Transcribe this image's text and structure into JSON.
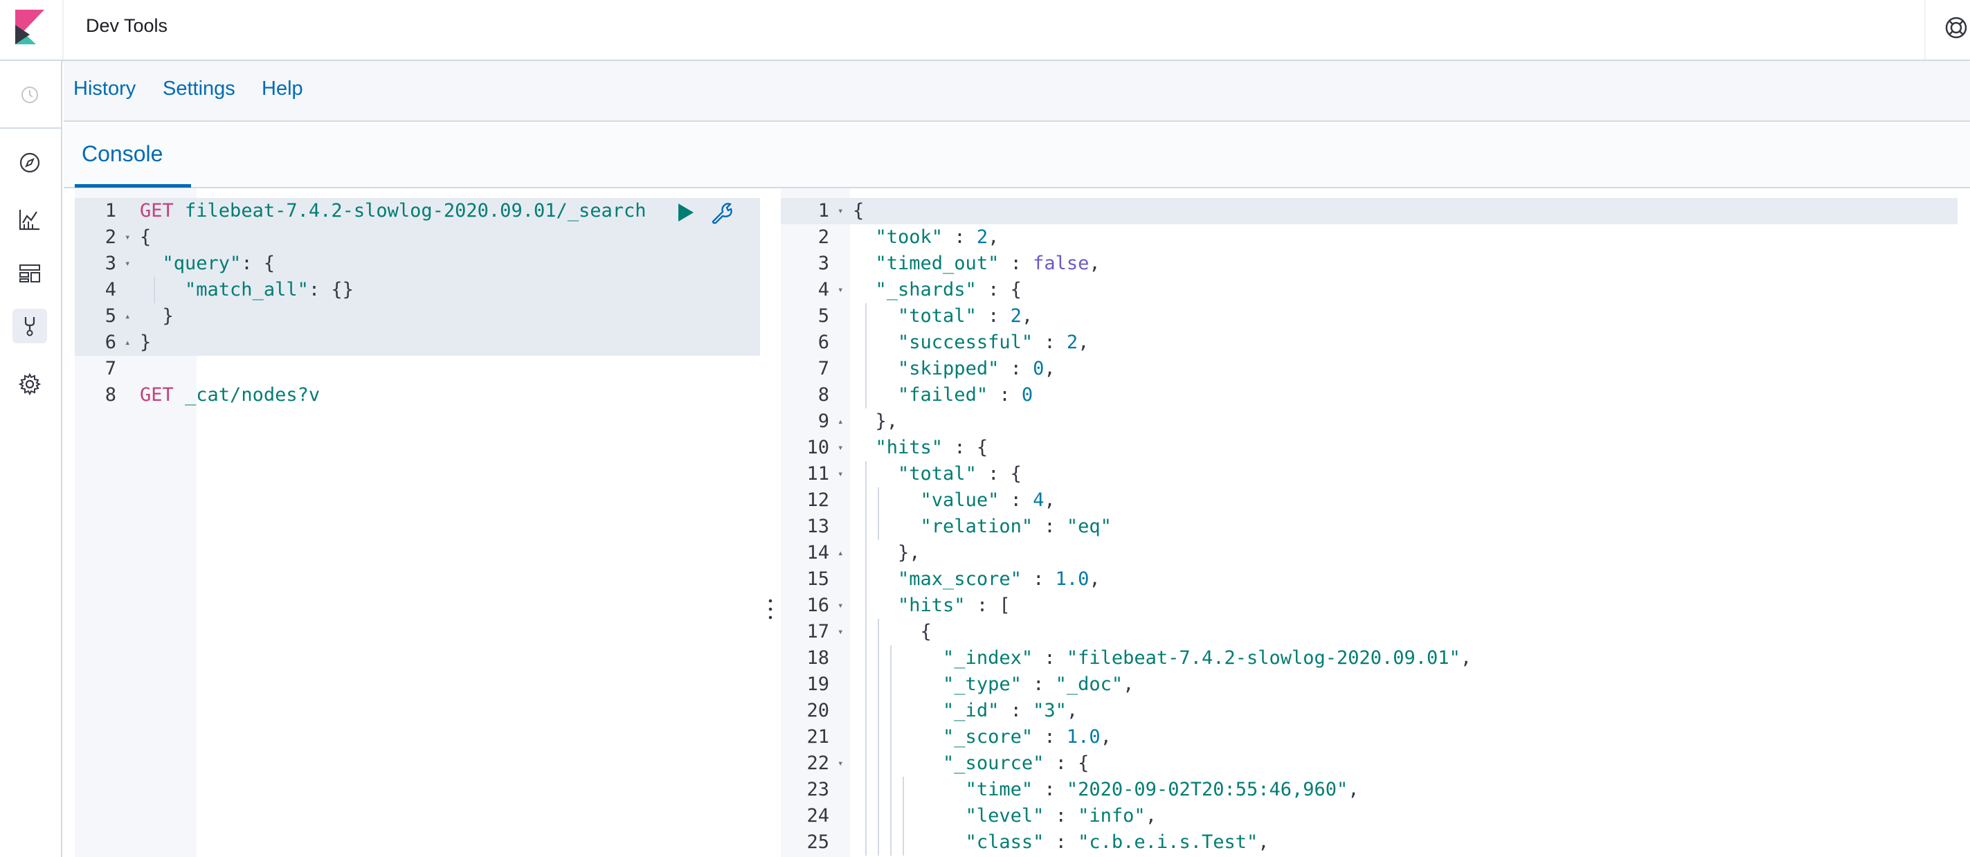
{
  "header": {
    "title": "Dev Tools"
  },
  "topmenu": {
    "items": [
      "History",
      "Settings",
      "Help"
    ]
  },
  "tabs": {
    "active": "Console"
  },
  "nav_icons": [
    "clock-icon",
    "discover-compass-icon",
    "visualize-chart-icon",
    "dashboard-icon",
    "dev-tools-wrench-icon",
    "management-gear-icon"
  ],
  "request": {
    "lines": [
      {
        "n": "1",
        "fold": "",
        "parts": [
          [
            "k-method",
            "GET"
          ],
          [
            "k-url",
            " filebeat-7.4.2-slowlog-2020.09.01/_search"
          ]
        ]
      },
      {
        "n": "2",
        "fold": "▾",
        "parts": [
          [
            "k-punc",
            "{"
          ]
        ]
      },
      {
        "n": "3",
        "fold": "▾",
        "parts": [
          [
            "k-punc",
            "  "
          ],
          [
            "k-key",
            "\"query\""
          ],
          [
            "k-punc",
            ": {"
          ]
        ]
      },
      {
        "n": "4",
        "fold": "",
        "parts": [
          [
            "k-punc",
            "    "
          ],
          [
            "k-key",
            "\"match_all\""
          ],
          [
            "k-punc",
            ": {}"
          ]
        ]
      },
      {
        "n": "5",
        "fold": "▴",
        "parts": [
          [
            "k-punc",
            "  }"
          ]
        ]
      },
      {
        "n": "6",
        "fold": "▴",
        "parts": [
          [
            "k-punc",
            "}"
          ]
        ]
      },
      {
        "n": "7",
        "fold": "",
        "parts": []
      },
      {
        "n": "8",
        "fold": "",
        "parts": [
          [
            "k-method",
            "GET"
          ],
          [
            "k-url",
            " _cat/nodes?v"
          ]
        ]
      }
    ]
  },
  "response": {
    "lines": [
      {
        "n": "1",
        "fold": "▾",
        "parts": [
          [
            "k-punc",
            "{"
          ]
        ]
      },
      {
        "n": "2",
        "fold": "",
        "parts": [
          [
            "k-punc",
            "  "
          ],
          [
            "k-key",
            "\"took\""
          ],
          [
            "k-punc",
            " : "
          ],
          [
            "k-num",
            "2"
          ],
          [
            "k-punc",
            ","
          ]
        ]
      },
      {
        "n": "3",
        "fold": "",
        "parts": [
          [
            "k-punc",
            "  "
          ],
          [
            "k-key",
            "\"timed_out\""
          ],
          [
            "k-punc",
            " : "
          ],
          [
            "k-bool",
            "false"
          ],
          [
            "k-punc",
            ","
          ]
        ]
      },
      {
        "n": "4",
        "fold": "▾",
        "parts": [
          [
            "k-punc",
            "  "
          ],
          [
            "k-key",
            "\"_shards\""
          ],
          [
            "k-punc",
            " : {"
          ]
        ]
      },
      {
        "n": "5",
        "fold": "",
        "parts": [
          [
            "k-punc",
            "    "
          ],
          [
            "k-key",
            "\"total\""
          ],
          [
            "k-punc",
            " : "
          ],
          [
            "k-num",
            "2"
          ],
          [
            "k-punc",
            ","
          ]
        ]
      },
      {
        "n": "6",
        "fold": "",
        "parts": [
          [
            "k-punc",
            "    "
          ],
          [
            "k-key",
            "\"successful\""
          ],
          [
            "k-punc",
            " : "
          ],
          [
            "k-num",
            "2"
          ],
          [
            "k-punc",
            ","
          ]
        ]
      },
      {
        "n": "7",
        "fold": "",
        "parts": [
          [
            "k-punc",
            "    "
          ],
          [
            "k-key",
            "\"skipped\""
          ],
          [
            "k-punc",
            " : "
          ],
          [
            "k-num",
            "0"
          ],
          [
            "k-punc",
            ","
          ]
        ]
      },
      {
        "n": "8",
        "fold": "",
        "parts": [
          [
            "k-punc",
            "    "
          ],
          [
            "k-key",
            "\"failed\""
          ],
          [
            "k-punc",
            " : "
          ],
          [
            "k-num",
            "0"
          ]
        ]
      },
      {
        "n": "9",
        "fold": "▴",
        "parts": [
          [
            "k-punc",
            "  },"
          ]
        ]
      },
      {
        "n": "10",
        "fold": "▾",
        "parts": [
          [
            "k-punc",
            "  "
          ],
          [
            "k-key",
            "\"hits\""
          ],
          [
            "k-punc",
            " : {"
          ]
        ]
      },
      {
        "n": "11",
        "fold": "▾",
        "parts": [
          [
            "k-punc",
            "    "
          ],
          [
            "k-key",
            "\"total\""
          ],
          [
            "k-punc",
            " : {"
          ]
        ]
      },
      {
        "n": "12",
        "fold": "",
        "parts": [
          [
            "k-punc",
            "      "
          ],
          [
            "k-key",
            "\"value\""
          ],
          [
            "k-punc",
            " : "
          ],
          [
            "k-num",
            "4"
          ],
          [
            "k-punc",
            ","
          ]
        ]
      },
      {
        "n": "13",
        "fold": "",
        "parts": [
          [
            "k-punc",
            "      "
          ],
          [
            "k-key",
            "\"relation\""
          ],
          [
            "k-punc",
            " : "
          ],
          [
            "k-str",
            "\"eq\""
          ]
        ]
      },
      {
        "n": "14",
        "fold": "▴",
        "parts": [
          [
            "k-punc",
            "    },"
          ]
        ]
      },
      {
        "n": "15",
        "fold": "",
        "parts": [
          [
            "k-punc",
            "    "
          ],
          [
            "k-key",
            "\"max_score\""
          ],
          [
            "k-punc",
            " : "
          ],
          [
            "k-num",
            "1.0"
          ],
          [
            "k-punc",
            ","
          ]
        ]
      },
      {
        "n": "16",
        "fold": "▾",
        "parts": [
          [
            "k-punc",
            "    "
          ],
          [
            "k-key",
            "\"hits\""
          ],
          [
            "k-punc",
            " : ["
          ]
        ]
      },
      {
        "n": "17",
        "fold": "▾",
        "parts": [
          [
            "k-punc",
            "      {"
          ]
        ]
      },
      {
        "n": "18",
        "fold": "",
        "parts": [
          [
            "k-punc",
            "        "
          ],
          [
            "k-key",
            "\"_index\""
          ],
          [
            "k-punc",
            " : "
          ],
          [
            "k-str",
            "\"filebeat-7.4.2-slowlog-2020.09.01\""
          ],
          [
            "k-punc",
            ","
          ]
        ]
      },
      {
        "n": "19",
        "fold": "",
        "parts": [
          [
            "k-punc",
            "        "
          ],
          [
            "k-key",
            "\"_type\""
          ],
          [
            "k-punc",
            " : "
          ],
          [
            "k-str",
            "\"_doc\""
          ],
          [
            "k-punc",
            ","
          ]
        ]
      },
      {
        "n": "20",
        "fold": "",
        "parts": [
          [
            "k-punc",
            "        "
          ],
          [
            "k-key",
            "\"_id\""
          ],
          [
            "k-punc",
            " : "
          ],
          [
            "k-str",
            "\"3\""
          ],
          [
            "k-punc",
            ","
          ]
        ]
      },
      {
        "n": "21",
        "fold": "",
        "parts": [
          [
            "k-punc",
            "        "
          ],
          [
            "k-key",
            "\"_score\""
          ],
          [
            "k-punc",
            " : "
          ],
          [
            "k-num",
            "1.0"
          ],
          [
            "k-punc",
            ","
          ]
        ]
      },
      {
        "n": "22",
        "fold": "▾",
        "parts": [
          [
            "k-punc",
            "        "
          ],
          [
            "k-key",
            "\"_source\""
          ],
          [
            "k-punc",
            " : {"
          ]
        ]
      },
      {
        "n": "23",
        "fold": "",
        "parts": [
          [
            "k-punc",
            "          "
          ],
          [
            "k-key",
            "\"time\""
          ],
          [
            "k-punc",
            " : "
          ],
          [
            "k-str",
            "\"2020-09-02T20:55:46,960\""
          ],
          [
            "k-punc",
            ","
          ]
        ]
      },
      {
        "n": "24",
        "fold": "",
        "parts": [
          [
            "k-punc",
            "          "
          ],
          [
            "k-key",
            "\"level\""
          ],
          [
            "k-punc",
            " : "
          ],
          [
            "k-str",
            "\"info\""
          ],
          [
            "k-punc",
            ","
          ]
        ]
      },
      {
        "n": "25",
        "fold": "",
        "parts": [
          [
            "k-punc",
            "          "
          ],
          [
            "k-key",
            "\"class\""
          ],
          [
            "k-punc",
            " : "
          ],
          [
            "k-str",
            "\"c.b.e.i.s.Test\""
          ],
          [
            "k-punc",
            ","
          ]
        ]
      }
    ]
  },
  "colors": {
    "link": "#006bb4",
    "method": "#c4407c",
    "string": "#017d73",
    "number": "#0079a5",
    "run_button": "#017d73"
  }
}
